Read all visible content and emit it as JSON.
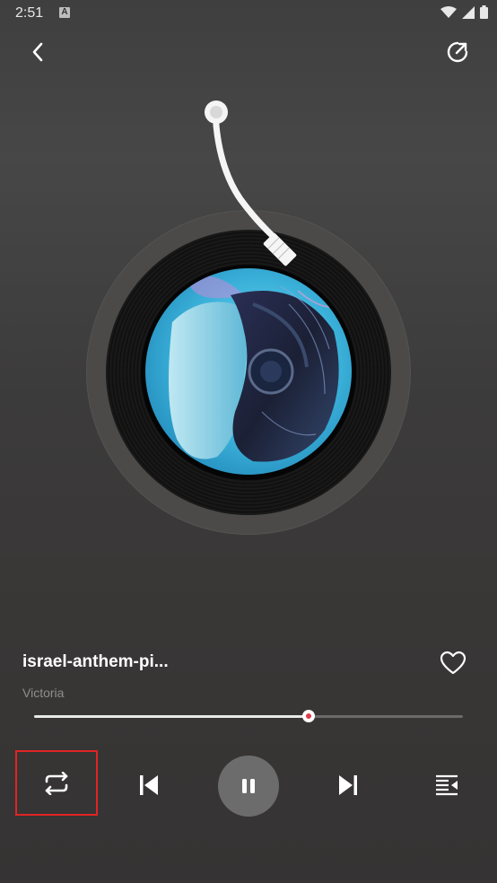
{
  "status_bar": {
    "time": "2:51",
    "notification_icon": "a-square-icon",
    "icons": [
      "wifi-icon",
      "signal-icon",
      "battery-icon"
    ]
  },
  "header": {
    "back_icon": "chevron-left-icon",
    "share_icon": "share-external-icon"
  },
  "track": {
    "title": "israel-anthem-pi...",
    "artist": "Victoria",
    "favorite_icon": "heart-outline-icon",
    "progress": 0.64
  },
  "controls": {
    "repeat_icon": "repeat-icon",
    "previous_icon": "skip-previous-icon",
    "play_pause_icon": "pause-icon",
    "next_icon": "skip-next-icon",
    "queue_icon": "playlist-icon"
  },
  "colors": {
    "accent": "#e23a4c",
    "highlight_box": "#e02424",
    "artist_text": "#8e8e8e"
  }
}
